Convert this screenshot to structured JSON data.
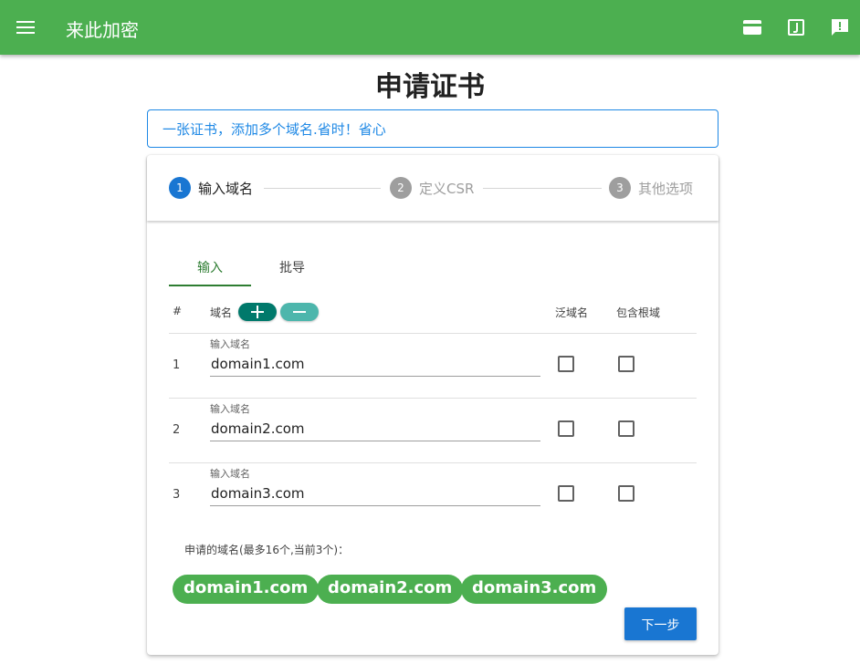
{
  "app": {
    "title": "来此加密",
    "icons": [
      "menu-icon",
      "credit-card-icon",
      "bookmark-j-icon",
      "feedback-icon"
    ]
  },
  "page": {
    "title": "申请证书",
    "alert": "一张证书，添加多个域名.省时！省心"
  },
  "stepper": {
    "steps": [
      {
        "number": "1",
        "label": "输入域名",
        "active": true
      },
      {
        "number": "2",
        "label": "定义CSR",
        "active": false
      },
      {
        "number": "3",
        "label": "其他选项",
        "active": false
      }
    ]
  },
  "tabs": [
    {
      "label": "输入",
      "active": true
    },
    {
      "label": "批导",
      "active": false
    }
  ],
  "table": {
    "headers": {
      "index": "#",
      "domain": "域名",
      "wildcard": "泛域名",
      "root": "包含根域"
    },
    "rows": [
      {
        "index": "1",
        "label": "输入域名",
        "value": "domain1.com",
        "wildcard": false,
        "root": false
      },
      {
        "index": "2",
        "label": "输入域名",
        "value": "domain2.com",
        "wildcard": false,
        "root": false
      },
      {
        "index": "3",
        "label": "输入域名",
        "value": "domain3.com",
        "wildcard": false,
        "root": false
      }
    ]
  },
  "summary": "申请的域名(最多16个,当前3个)：",
  "chips": [
    "domain1.com",
    "domain2.com",
    "domain3.com"
  ],
  "next_button": "下一步",
  "colors": {
    "appbar": "#4caf50",
    "primary_blue": "#1976d2",
    "alert_blue": "#1e88e5",
    "teal_dark": "#00796b",
    "teal_light": "#4db6ac",
    "step_inactive": "#9e9e9e",
    "tab_active": "#2e7d32"
  }
}
